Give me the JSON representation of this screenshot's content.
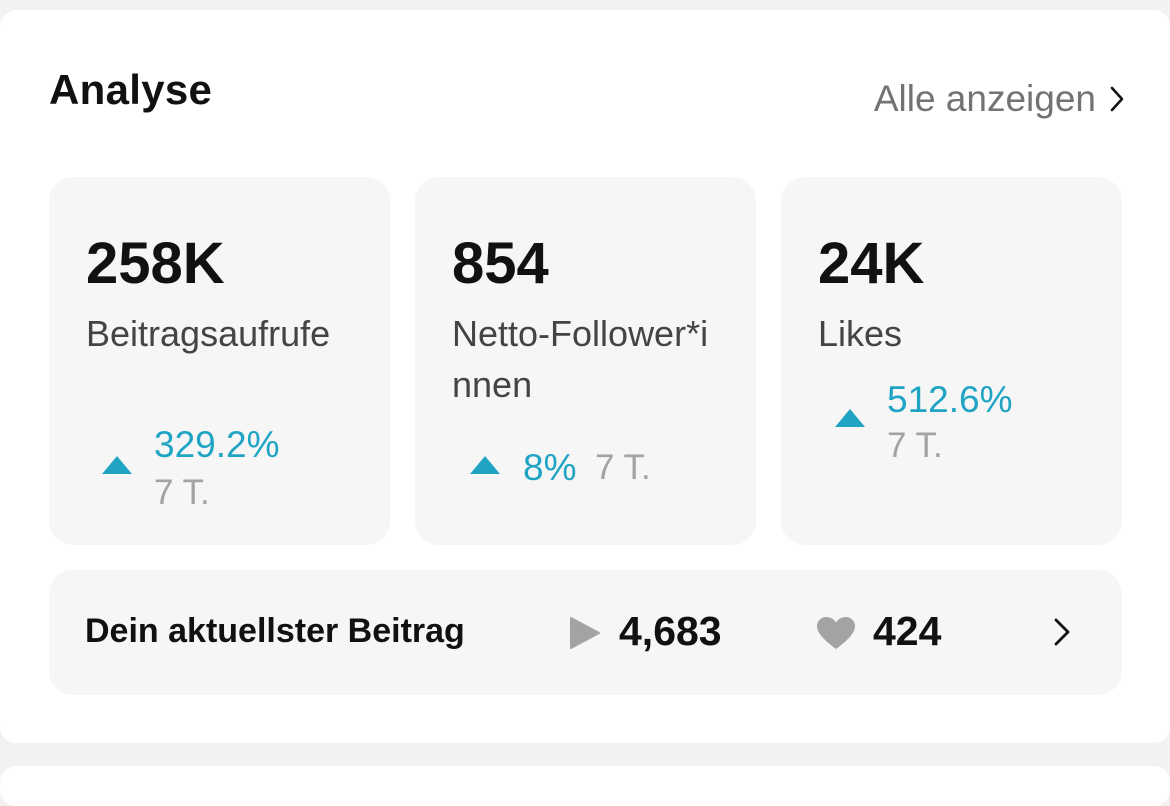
{
  "header": {
    "title": "Analyse",
    "see_all": "Alle anzeigen"
  },
  "stats": [
    {
      "value": "258K",
      "label": "Beitragsaufrufe",
      "change": "329.2%",
      "period": "7 T."
    },
    {
      "value": "854",
      "label": "Netto-Follower*innen",
      "change": "8%",
      "period": "7 T."
    },
    {
      "value": "24K",
      "label": "Likes",
      "change": "512.6%",
      "period": "7 T."
    }
  ],
  "latest_post": {
    "title": "Dein aktuellster Beitrag",
    "views": "4,683",
    "likes": "424"
  },
  "icons": {
    "trend": "triangle-up-icon",
    "play": "play-icon",
    "heart": "heart-icon",
    "chevron": "chevron-right-icon"
  },
  "colors": {
    "accent": "#20a4c4",
    "muted": "#a3a3a3",
    "tile_bg": "#f6f6f6"
  }
}
